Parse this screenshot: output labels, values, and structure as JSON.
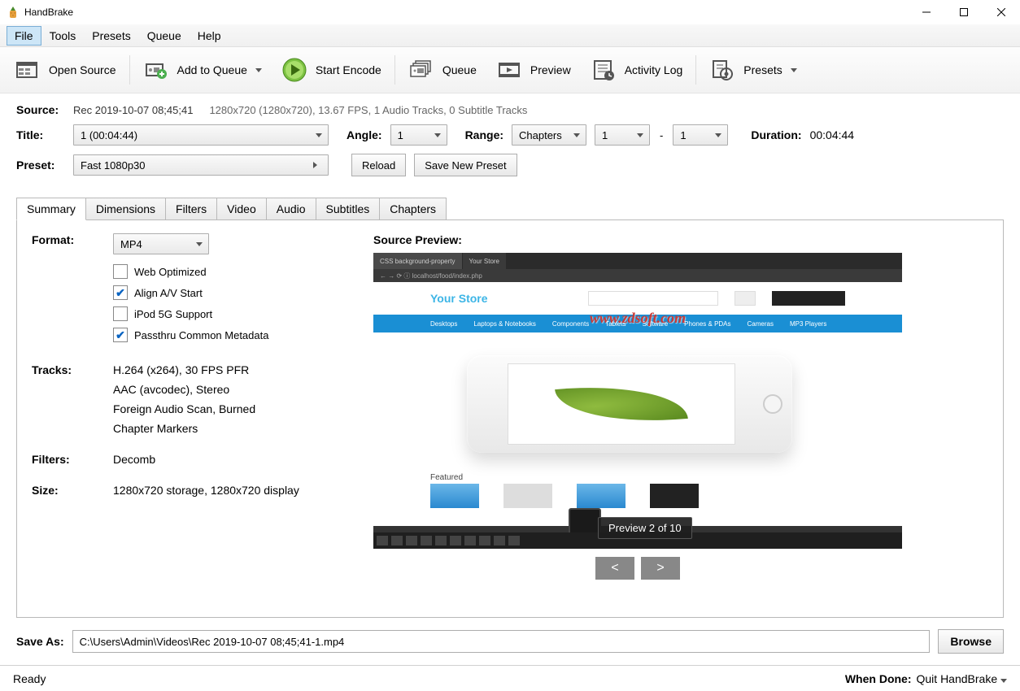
{
  "window": {
    "title": "HandBrake"
  },
  "menubar": [
    "File",
    "Tools",
    "Presets",
    "Queue",
    "Help"
  ],
  "toolbar": {
    "open_source": "Open Source",
    "add_queue": "Add to Queue",
    "start_encode": "Start Encode",
    "queue": "Queue",
    "preview": "Preview",
    "activity_log": "Activity Log",
    "presets": "Presets"
  },
  "source": {
    "label": "Source:",
    "name": "Rec 2019-10-07 08;45;41",
    "info": "1280x720 (1280x720), 13.67 FPS, 1 Audio Tracks, 0 Subtitle Tracks"
  },
  "title_row": {
    "title_label": "Title:",
    "title_value": "1  (00:04:44)",
    "angle_label": "Angle:",
    "angle_value": "1",
    "range_label": "Range:",
    "range_type": "Chapters",
    "range_from": "1",
    "range_to": "1",
    "duration_label": "Duration:",
    "duration_value": "00:04:44"
  },
  "preset_row": {
    "label": "Preset:",
    "value": "Fast 1080p30",
    "reload": "Reload",
    "save_new": "Save New Preset"
  },
  "tabs": [
    "Summary",
    "Dimensions",
    "Filters",
    "Video",
    "Audio",
    "Subtitles",
    "Chapters"
  ],
  "summary": {
    "format_label": "Format:",
    "format_value": "MP4",
    "checks": {
      "web_optimized": "Web Optimized",
      "align_av": "Align A/V Start",
      "ipod": "iPod 5G Support",
      "passthru": "Passthru Common Metadata"
    },
    "tracks_label": "Tracks:",
    "tracks": [
      "H.264 (x264), 30 FPS PFR",
      "AAC (avcodec), Stereo",
      "Foreign Audio Scan, Burned",
      "Chapter Markers"
    ],
    "filters_label": "Filters:",
    "filters_value": "Decomb",
    "size_label": "Size:",
    "size_value": "1280x720 storage, 1280x720 display"
  },
  "preview": {
    "title": "Source Preview:",
    "tooltip": "Preview 2 of 10",
    "watermark": "www.zdsoft.com",
    "store_title": "Your Store",
    "featured": "Featured"
  },
  "save_as": {
    "label": "Save As:",
    "path": "C:\\Users\\Admin\\Videos\\Rec 2019-10-07 08;45;41-1.mp4",
    "browse": "Browse"
  },
  "status": {
    "ready": "Ready",
    "when_done_label": "When Done:",
    "when_done_value": "Quit HandBrake"
  }
}
